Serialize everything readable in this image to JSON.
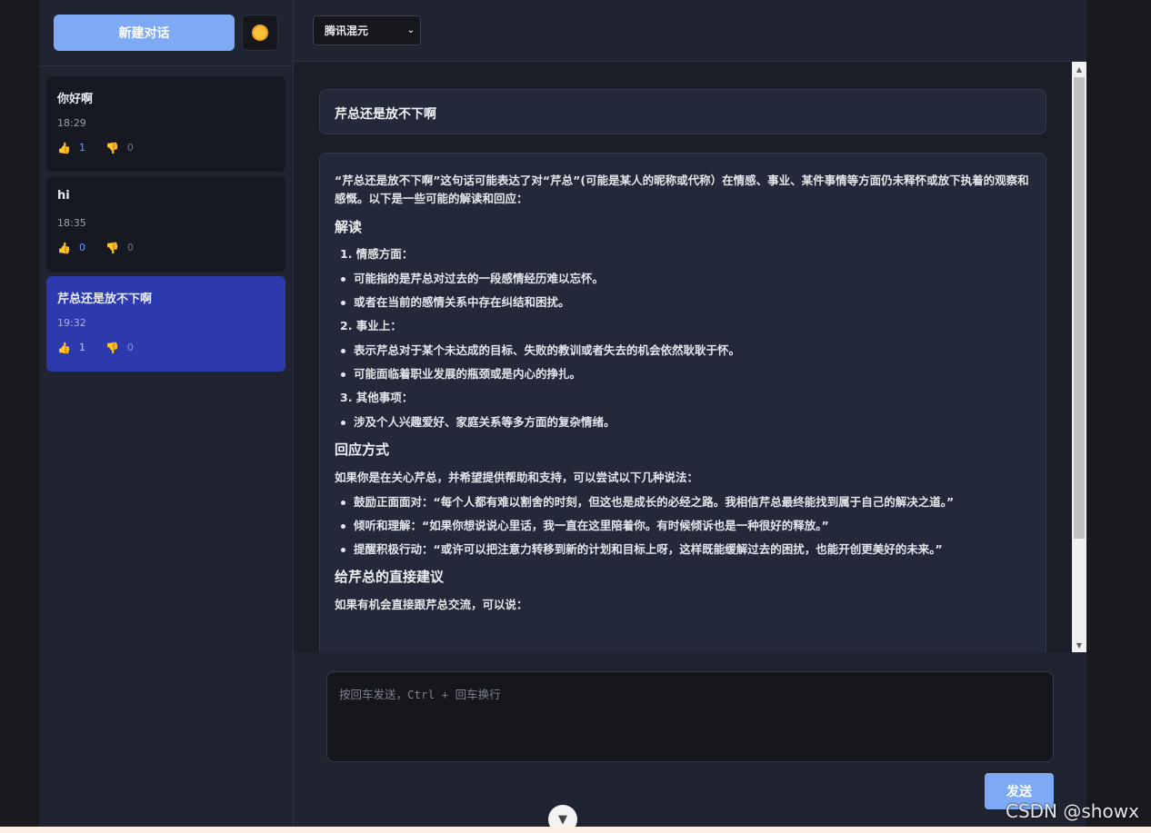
{
  "sidebar": {
    "new_chat_label": "新建对话",
    "theme_icon": "sun-icon",
    "conversations": [
      {
        "title": "你好啊",
        "time": "18:29",
        "likes": "1",
        "dislikes": "0",
        "active": false
      },
      {
        "title": "hi",
        "time": "18:35",
        "likes": "0",
        "dislikes": "0",
        "active": false
      },
      {
        "title": "芹总还是放不下啊",
        "time": "19:32",
        "likes": "1",
        "dislikes": "0",
        "active": true
      }
    ]
  },
  "header": {
    "model_selected": "腾讯混元"
  },
  "chat": {
    "user_message": "芹总还是放不下啊",
    "bot": {
      "intro": "“芹总还是放不下啊”这句话可能表达了对“芹总”(可能是某人的昵称或代称）在情感、事业、某件事情等方面仍未释怀或放下执着的观察和感慨。以下是一些可能的解读和回应：",
      "h_interpret": "解读",
      "ol1": "1. 情感方面：",
      "ol1_items": [
        "可能指的是芹总对过去的一段感情经历难以忘怀。",
        "或者在当前的感情关系中存在纠结和困扰。"
      ],
      "ol2": "2. 事业上：",
      "ol2_items": [
        "表示芹总对于某个未达成的目标、失败的教训或者失去的机会依然耿耿于怀。",
        "可能面临着职业发展的瓶颈或是内心的挣扎。"
      ],
      "ol3": "3. 其他事项：",
      "ol3_items": [
        "涉及个人兴趣爱好、家庭关系等多方面的复杂情绪。"
      ],
      "h_response": "回应方式",
      "response_intro": "如果你是在关心芹总，并希望提供帮助和支持，可以尝试以下几种说法：",
      "response_items": [
        "鼓励正面面对：“每个人都有难以割舍的时刻，但这也是成长的必经之路。我相信芹总最终能找到属于自己的解决之道。”",
        "倾听和理解：“如果你想说说心里话，我一直在这里陪着你。有时候倾诉也是一种很好的释放。”",
        "提醒积极行动：“或许可以把注意力转移到新的计划和目标上呀，这样既能缓解过去的困扰，也能开创更美好的未来。”"
      ],
      "h_advice": "给芹总的直接建议",
      "advice_intro": "如果有机会直接跟芹总交流，可以说："
    }
  },
  "composer": {
    "placeholder": "按回车发送，Ctrl + 回车换行",
    "send_label": "发送"
  },
  "watermark": "CSDN @showx"
}
